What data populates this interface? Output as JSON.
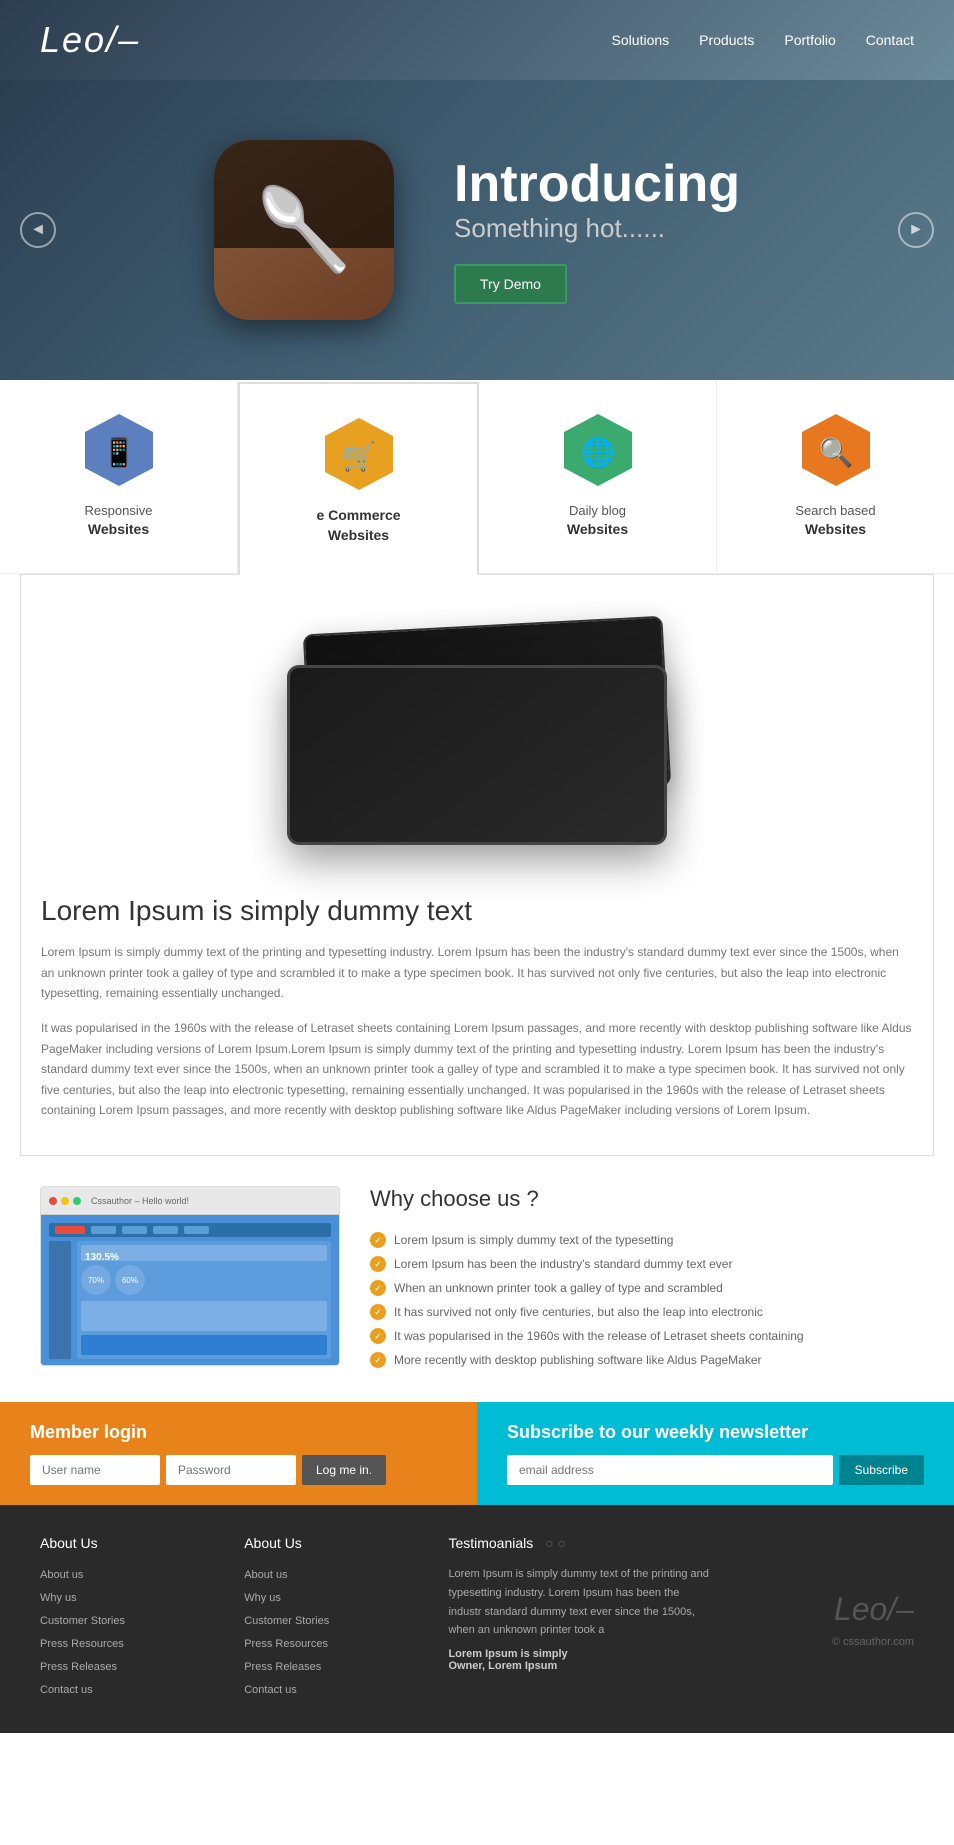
{
  "header": {
    "logo": "Leo/–",
    "nav": [
      "Solutions",
      "Products",
      "Portfolio",
      "Contact"
    ]
  },
  "hero": {
    "title": "Introducing",
    "subtitle": "Something hot......",
    "cta": "Try Demo",
    "arrow_left": "◄",
    "arrow_right": "►"
  },
  "features": [
    {
      "id": "responsive",
      "label": "Responsive",
      "label2": "Websites",
      "color": "#5b7fbf",
      "active": false
    },
    {
      "id": "ecommerce",
      "label": "e Commerce",
      "label2": "Websites",
      "color": "#e8a020",
      "active": true
    },
    {
      "id": "daily-blog",
      "label": "Daily blog",
      "label2": "Websites",
      "color": "#3aaa6e",
      "active": false
    },
    {
      "id": "search-based",
      "label": "Search based",
      "label2": "Websites",
      "color": "#e87820",
      "active": false
    }
  ],
  "content": {
    "title": "Lorem Ipsum is simply dummy text",
    "para1": "Lorem Ipsum is simply dummy text of the printing and typesetting industry. Lorem Ipsum has been the industry's standard dummy text ever since the 1500s, when an unknown printer took a galley of type and scrambled it to make a type specimen book. It has survived not only five centuries, but also the leap into electronic typesetting, remaining essentially unchanged.",
    "para2": "It was popularised in the 1960s with the release of Letraset sheets containing Lorem Ipsum passages, and more recently with desktop publishing software like Aldus PageMaker including versions of Lorem Ipsum.Lorem Ipsum is simply dummy text of the printing and typesetting industry. Lorem Ipsum has been the industry's standard dummy text ever since the 1500s, when an unknown printer took a galley of type and scrambled it to make a type specimen book. It has survived not only five centuries, but also the leap into electronic typesetting, remaining essentially unchanged. It was popularised in the 1960s with the release of Letraset sheets containing Lorem Ipsum passages, and more recently with desktop publishing software like Aldus PageMaker including versions of Lorem Ipsum."
  },
  "why": {
    "title": "Why choose us ?",
    "points": [
      "Lorem Ipsum is simply dummy text of the typesetting",
      "Lorem Ipsum has been the industry's standard dummy text ever",
      "When an unknown printer took a galley of type and scrambled",
      "It has survived not only five centuries, but also the leap into electronic",
      "It was popularised in the 1960s with the release of Letraset sheets containing",
      "More recently with desktop publishing software like Aldus PageMaker"
    ],
    "browser_title": "Cssauthor – Hello world!"
  },
  "login": {
    "title": "Member login",
    "username_placeholder": "User name",
    "password_placeholder": "Password",
    "button": "Log me in."
  },
  "newsletter": {
    "title": "Subscribe to our weekly newsletter",
    "email_placeholder": "email address",
    "button": "Subscribe"
  },
  "footer": {
    "col1_title": "About Us",
    "col1_links": [
      "About us",
      "Why us",
      "Customer Stories",
      "Press Resources",
      "Press Releases",
      "Contact us"
    ],
    "col2_title": "About Us",
    "col2_links": [
      "About us",
      "Why us",
      "Customer Stories",
      "Press Resources",
      "Press Releases",
      "Contact us"
    ],
    "testimonials_title": "Testimoanials",
    "testimonial_text": "Lorem Ipsum is simply dummy text of the printing and typesetting industry. Lorem Ipsum has been the industr standard dummy text ever since the 1500s, when an unknown printer took a",
    "testimonial_bold1": "Lorem Ipsum is simply",
    "testimonial_bold2": "Owner, Lorem Ipsum",
    "logo": "Leo/–",
    "copyright": "© cssauthor.com"
  }
}
